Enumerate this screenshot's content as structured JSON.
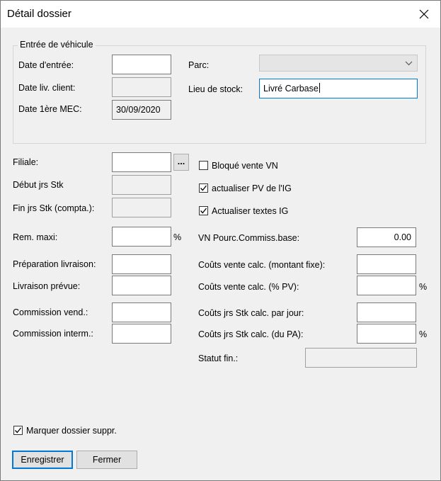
{
  "window": {
    "title": "Détail dossier"
  },
  "vehicle_entry": {
    "group_label": "Entrée de véhicule",
    "date_entree_label": "Date d'entrée:",
    "date_entree_value": "",
    "date_liv_client_label": "Date liv. client:",
    "date_liv_client_value": "",
    "date_1ere_mec_label": "Date 1ère MEC:",
    "date_1ere_mec_value": "30/09/2020",
    "parc_label": "Parc:",
    "parc_value": "",
    "lieu_stock_label": "Lieu de stock:",
    "lieu_stock_value": "Livré Carbase"
  },
  "left": {
    "filiale_label": "Filiale:",
    "filiale_value": "",
    "browse_label": "...",
    "debut_jrs_label": "Début jrs Stk",
    "debut_jrs_value": "",
    "fin_jrs_label": "Fin jrs Stk (compta.):",
    "fin_jrs_value": "",
    "rem_maxi_label": "Rem. maxi:",
    "rem_maxi_value": "",
    "percent": "%",
    "preparation_label": "Préparation livraison:",
    "preparation_value": "",
    "livraison_label": "Livraison prévue:",
    "livraison_value": "",
    "commission_vend_label": "Commission vend.:",
    "commission_vend_value": "",
    "commission_interm_label": "Commission interm.:",
    "commission_interm_value": ""
  },
  "right": {
    "bloque_label": "Bloqué vente VN",
    "bloque_checked": false,
    "actualiser_pv_label": "actualiser PV de l'IG",
    "actualiser_pv_checked": true,
    "actualiser_textes_label": "Actualiser textes IG",
    "actualiser_textes_checked": true,
    "vn_pourc_label": "VN Pourc.Commiss.base:",
    "vn_pourc_value": "0.00",
    "couts_fixe_label": "Coûts vente calc. (montant fixe):",
    "couts_fixe_value": "",
    "couts_pv_label": "Coûts vente calc. (% PV):",
    "couts_pv_value": "",
    "couts_jour_label": "Coûts jrs Stk calc. par jour:",
    "couts_jour_value": "",
    "couts_pa_label": "Coûts jrs Stk calc. (du PA):",
    "couts_pa_value": "",
    "statut_label": "Statut fin.:",
    "statut_value": "",
    "percent": "%"
  },
  "footer": {
    "marquer_label": "Marquer dossier suppr.",
    "marquer_checked": true,
    "enregistrer_label": "Enregistrer",
    "fermer_label": "Fermer"
  }
}
